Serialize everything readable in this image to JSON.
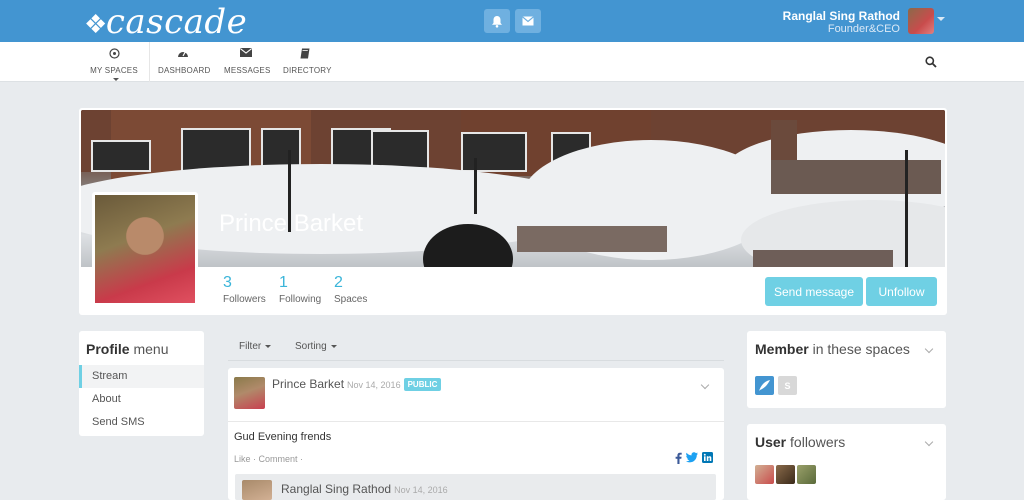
{
  "brand": {
    "logo_text": "cascade"
  },
  "header": {
    "user_name": "Ranglal Sing Rathod",
    "user_title": "Founder&CEO"
  },
  "nav": {
    "items": [
      {
        "label": "MY SPACES",
        "icon": "target-icon"
      },
      {
        "label": "DASHBOARD",
        "icon": "dashboard-icon"
      },
      {
        "label": "MESSAGES",
        "icon": "envelope-icon"
      },
      {
        "label": "DIRECTORY",
        "icon": "book-icon"
      }
    ]
  },
  "profile": {
    "name": "Prince Barket",
    "stats": [
      {
        "value": "3",
        "label": "Followers"
      },
      {
        "value": "1",
        "label": "Following"
      },
      {
        "value": "2",
        "label": "Spaces"
      }
    ],
    "send_message_label": "Send message",
    "unfollow_label": "Unfollow"
  },
  "profile_menu": {
    "title_bold": "Profile",
    "title_rest": " menu",
    "items": [
      "Stream",
      "About",
      "Send SMS"
    ]
  },
  "stream": {
    "filter_label": "Filter",
    "sorting_label": "Sorting",
    "post": {
      "author": "Prince Barket",
      "date": "Nov 14, 2016",
      "visibility": "PUBLIC",
      "text": "Gud Evening frends",
      "like_label": "Like",
      "comment_label": "Comment",
      "comment_author": "Ranglal Sing Rathod",
      "comment_date": "Nov 14, 2016"
    }
  },
  "member_spaces": {
    "title_bold": "Member",
    "title_rest": " in these spaces",
    "second_space_initial": "S"
  },
  "user_followers": {
    "title_bold": "User",
    "title_rest": " followers"
  },
  "colors": {
    "topbar": "#4395d1",
    "accent": "#6fd0e4",
    "stat": "#3bb5d9"
  }
}
